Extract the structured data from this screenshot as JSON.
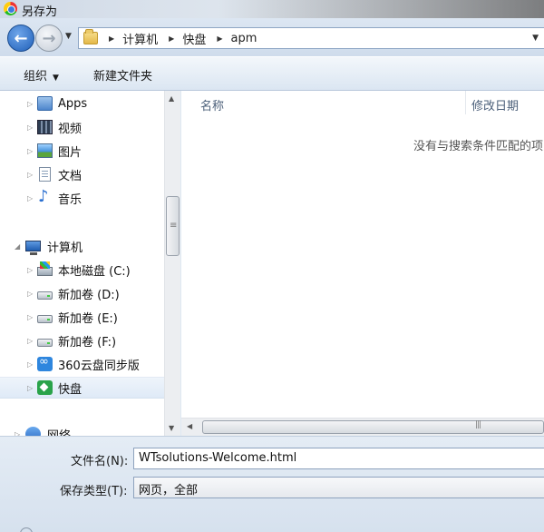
{
  "window": {
    "title": "另存为"
  },
  "address": {
    "crumbs": [
      "计算机",
      "快盘",
      "apm"
    ]
  },
  "toolbar": {
    "organize": "组织",
    "new_folder": "新建文件夹"
  },
  "sidebar": {
    "items": [
      {
        "label": "Apps"
      },
      {
        "label": "视频"
      },
      {
        "label": "图片"
      },
      {
        "label": "文档"
      },
      {
        "label": "音乐"
      },
      {
        "label": "计算机"
      },
      {
        "label": "本地磁盘 (C:)"
      },
      {
        "label": "新加卷 (D:)"
      },
      {
        "label": "新加卷 (E:)"
      },
      {
        "label": "新加卷 (F:)"
      },
      {
        "label": "360云盘同步版"
      },
      {
        "label": "快盘"
      },
      {
        "label": "网络"
      }
    ]
  },
  "filelist": {
    "col_name": "名称",
    "col_date": "修改日期",
    "empty_message": "没有与搜索条件匹配的项"
  },
  "form": {
    "filename_label": "文件名(N):",
    "filename_value": "WTsolutions-Welcome.html",
    "filetype_label": "保存类型(T):",
    "filetype_value": "网页，全部"
  }
}
